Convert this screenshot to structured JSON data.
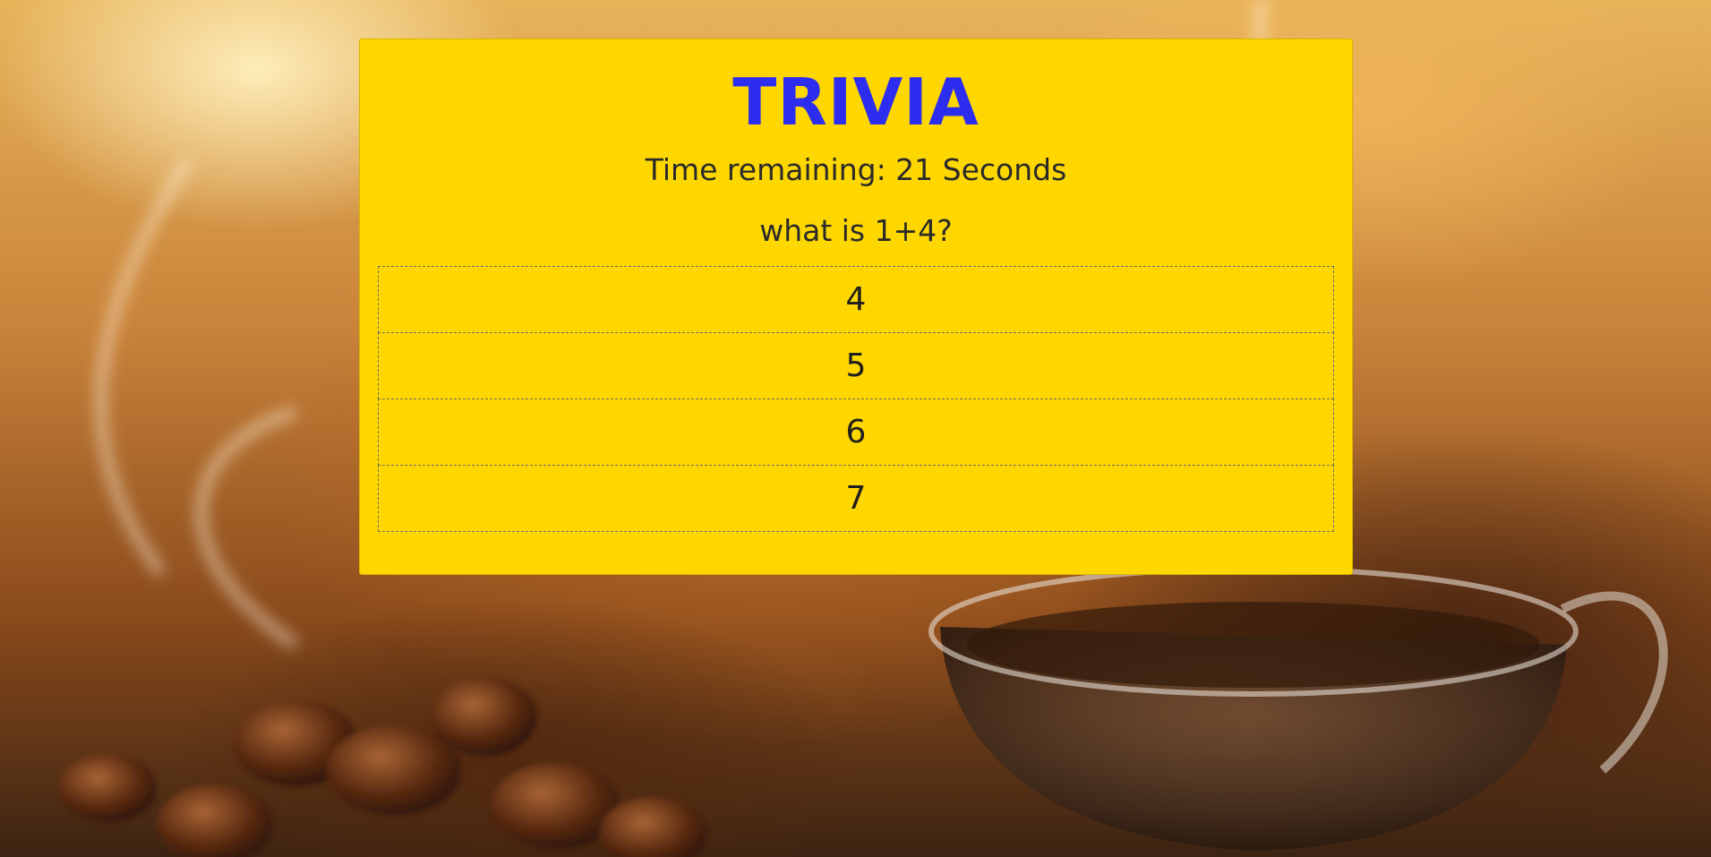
{
  "game": {
    "title": "TRIVIA",
    "timer_text": "Time remaining: 21 Seconds",
    "question": "what is 1+4?",
    "answers": [
      {
        "label": "4"
      },
      {
        "label": "5"
      },
      {
        "label": "6"
      },
      {
        "label": "7"
      }
    ]
  },
  "colors": {
    "card_background": "#ffd700",
    "title": "#2d2df0",
    "text": "#2a2a2a"
  }
}
